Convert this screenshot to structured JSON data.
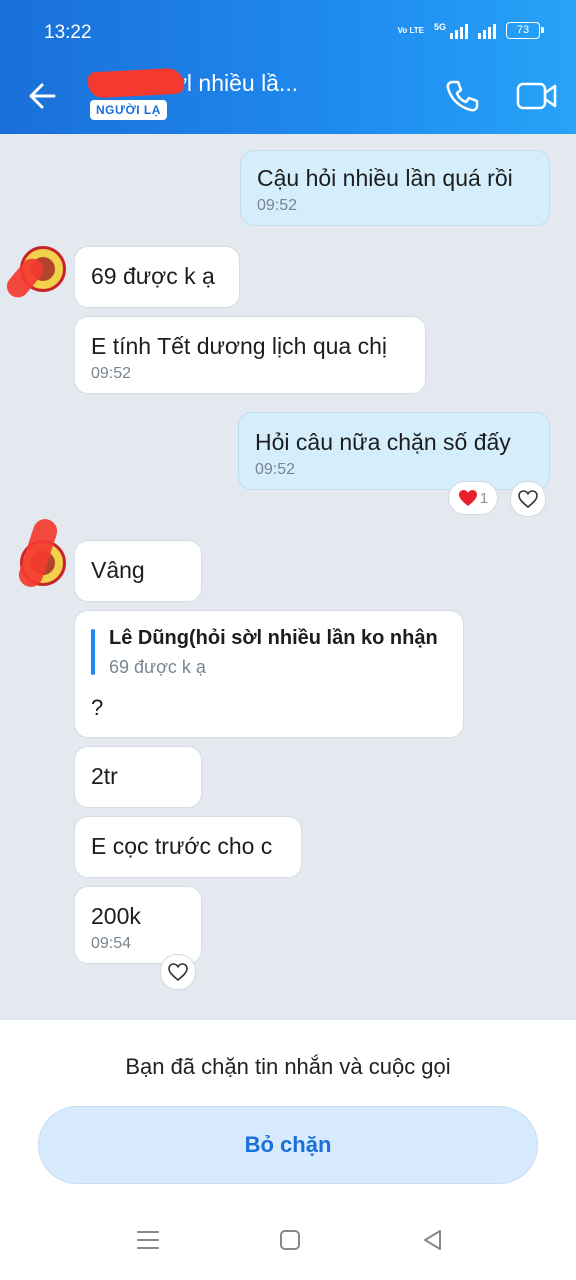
{
  "status_bar": {
    "time": "13:22",
    "volte": "Vo LTE",
    "net": "5G",
    "battery": "73"
  },
  "header": {
    "contact_name": "ng(hỏi sờl nhiều lầ...",
    "badge": "NGƯỜI LẠ",
    "back_icon": "arrow-left-icon",
    "call_icon": "phone-icon",
    "video_icon": "video-camera-icon"
  },
  "messages": [
    {
      "from": "me",
      "text": "Cậu hỏi nhiều lần quá rồi",
      "time": "09:52"
    },
    {
      "from": "them",
      "text": "69 được k ạ"
    },
    {
      "from": "them",
      "text": "E tính Tết dương lịch qua chị",
      "time": "09:52"
    },
    {
      "from": "me",
      "text": "Hỏi câu nữa chặn số đấy",
      "time": "09:52",
      "reaction_count": "1"
    },
    {
      "from": "them",
      "text": "Vâng"
    },
    {
      "from": "them",
      "quote_name": "Lê Dũng(hỏi sờl nhiều lần ko nhận",
      "quote_text": "69 được k ạ",
      "text": "?"
    },
    {
      "from": "them",
      "text": "2tr"
    },
    {
      "from": "them",
      "text": "E cọc trước cho c"
    },
    {
      "from": "them",
      "text": "200k",
      "time": "09:54"
    }
  ],
  "footer": {
    "blocked_notice": "Bạn đã chặn tin nhắn và cuộc gọi",
    "unblock_label": "Bỏ chặn"
  },
  "colors": {
    "header": "#1e88ef",
    "accent": "#1a6fd8",
    "chat_bg": "#e4e8ef",
    "my_bubble": "#d5eefc",
    "redaction": "#f4392f"
  }
}
